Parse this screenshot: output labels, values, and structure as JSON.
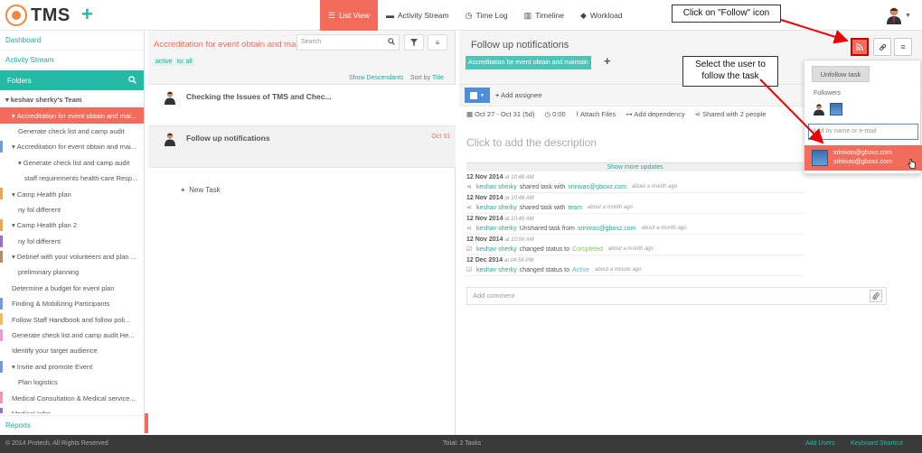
{
  "app": {
    "name": "TMS"
  },
  "nav": [
    {
      "label": "List View",
      "icon": "list-icon",
      "active": true
    },
    {
      "label": "Activity Stream",
      "icon": "comment-icon",
      "active": false
    },
    {
      "label": "Time Log",
      "icon": "clock-icon",
      "active": false
    },
    {
      "label": "Timeline",
      "icon": "timeline-icon",
      "active": false
    },
    {
      "label": "Workload",
      "icon": "user-icon",
      "active": false
    }
  ],
  "sidebar": {
    "links": [
      "Dashboard",
      "Activity Stream"
    ],
    "folders_label": "Folders",
    "tree": [
      {
        "label": "keshav sherky's Team",
        "indent": 0,
        "bar": "",
        "bold": true,
        "toggle": "▾"
      },
      {
        "label": "Accreditation for event obtain and mai...",
        "indent": 1,
        "bar": "#f26b5b",
        "selected": true,
        "toggle": "▾"
      },
      {
        "label": "Generate check list and camp audit",
        "indent": 2,
        "bar": ""
      },
      {
        "label": "Accreditation for event obtain and mai...",
        "indent": 1,
        "bar": "#7a9bd1",
        "toggle": "▾"
      },
      {
        "label": "Generate check list and camp audit",
        "indent": 2,
        "bar": "",
        "toggle": "▾"
      },
      {
        "label": "staff requirements health-care Resp...",
        "indent": 3,
        "bar": ""
      },
      {
        "label": "Camp Health plan",
        "indent": 1,
        "bar": "#e8a85a",
        "toggle": "▾"
      },
      {
        "label": "ny fol different",
        "indent": 2,
        "bar": ""
      },
      {
        "label": "Camp Health plan 2",
        "indent": 1,
        "bar": "#e8a85a",
        "toggle": "▾"
      },
      {
        "label": "ny fol different",
        "indent": 2,
        "bar": "#9b6fc4"
      },
      {
        "label": "Debrief with your volunteers and plan ...",
        "indent": 1,
        "bar": "#b58a6a",
        "toggle": "▾"
      },
      {
        "label": "preliminary planning",
        "indent": 2,
        "bar": ""
      },
      {
        "label": "Determine a budget for event plan",
        "indent": 1,
        "bar": ""
      },
      {
        "label": "Finding & Mobilizing Participants",
        "indent": 1,
        "bar": "#7a9bd1"
      },
      {
        "label": "Follow Staff Handbook and follow poli...",
        "indent": 1,
        "bar": "#e8c070"
      },
      {
        "label": "Generate check list and camp audit He...",
        "indent": 1,
        "bar": "#e89ad1"
      },
      {
        "label": "Identify your target audience",
        "indent": 1,
        "bar": ""
      },
      {
        "label": "Invite and promote Event",
        "indent": 1,
        "bar": "#7a9bd1",
        "toggle": "▾"
      },
      {
        "label": "Plan logistics",
        "indent": 2,
        "bar": ""
      },
      {
        "label": "Medical Consultation & Medical service...",
        "indent": 1,
        "bar": "#e89ab0"
      },
      {
        "label": "Medical Infor... ...",
        "indent": 1,
        "bar": "#9b6fc4"
      }
    ],
    "reports_label": "Reports"
  },
  "list": {
    "title": "Accreditation for event obtain and ma...",
    "search_placeholder": "Search",
    "tags": [
      "active",
      "to: all"
    ],
    "show_descendants": "Show Descendants",
    "sort_label": "Sort by",
    "sort_value": "Title",
    "tasks": [
      {
        "title": "Checking the Issues of TMS and Chec...",
        "date": ""
      },
      {
        "title": "Follow up notifications",
        "date": "Oct 31"
      }
    ],
    "new_task": "New Task"
  },
  "detail": {
    "title": "Follow up notifications",
    "folder_tag": "Accreditation for event obtain and maintain",
    "add_assignee": "Add assignee",
    "dates": "Oct 27 - Oct 31 (5d)",
    "time": "0:00",
    "attach": "Attach Files",
    "dependency": "Add dependency",
    "shared": "Shared with 2 people",
    "description_placeholder": "Click to add the description",
    "show_more": "Show more updates",
    "activity": [
      {
        "date": "12 Nov 2014",
        "time": "at 10:48 AM",
        "who": "keshav sherky",
        "pre": "shared task with",
        "obj": "srinivas@gboxz.com",
        "objcls": "teal",
        "post": "",
        "ago": "about a month ago",
        "icon": "share-icon"
      },
      {
        "date": "12 Nov 2014",
        "time": "at 10:48 AM",
        "who": "keshav sherky",
        "pre": "shared task with",
        "obj": "team",
        "objcls": "teal",
        "post": "",
        "ago": "about a month ago",
        "icon": "share-icon"
      },
      {
        "date": "12 Nov 2014",
        "time": "at 10:49 AM",
        "who": "keshav sherky",
        "pre": "Unshared task from",
        "obj": "srinivas@gboxz.com",
        "objcls": "teal",
        "post": "",
        "ago": "about a month ago",
        "icon": "share-icon"
      },
      {
        "date": "12 Nov 2014",
        "time": "at 10:50 AM",
        "who": "keshav sherky",
        "pre": "changed status to",
        "obj": "Completed",
        "objcls": "green",
        "post": "",
        "ago": "about a month ago",
        "icon": "status-icon"
      },
      {
        "date": "12 Dec 2014",
        "time": "at 04:56 PM",
        "who": "keshav sherky",
        "pre": "changed status to",
        "obj": "Active",
        "objcls": "blue",
        "post": "",
        "ago": "about a minute ago",
        "icon": "status-icon"
      }
    ],
    "comment_placeholder": "Add comment"
  },
  "follow_popup": {
    "unfollow": "Unfollow task",
    "followers_label": "Followers",
    "add_placeholder": "Add by name or e-mail",
    "suggestion_line1": "srinivas@gboxz.com",
    "suggestion_line2": "srinivas@gboxz.com"
  },
  "callouts": {
    "follow": "Click on \"Follow\" icon",
    "select": "Select the user to follow the task"
  },
  "footer": {
    "copyright": "© 2014 Protech, All Rights Reserved",
    "total": "Total: 2 Tasks",
    "add_users": "Add Users",
    "shortcut": "Keyboard Shortcut"
  }
}
